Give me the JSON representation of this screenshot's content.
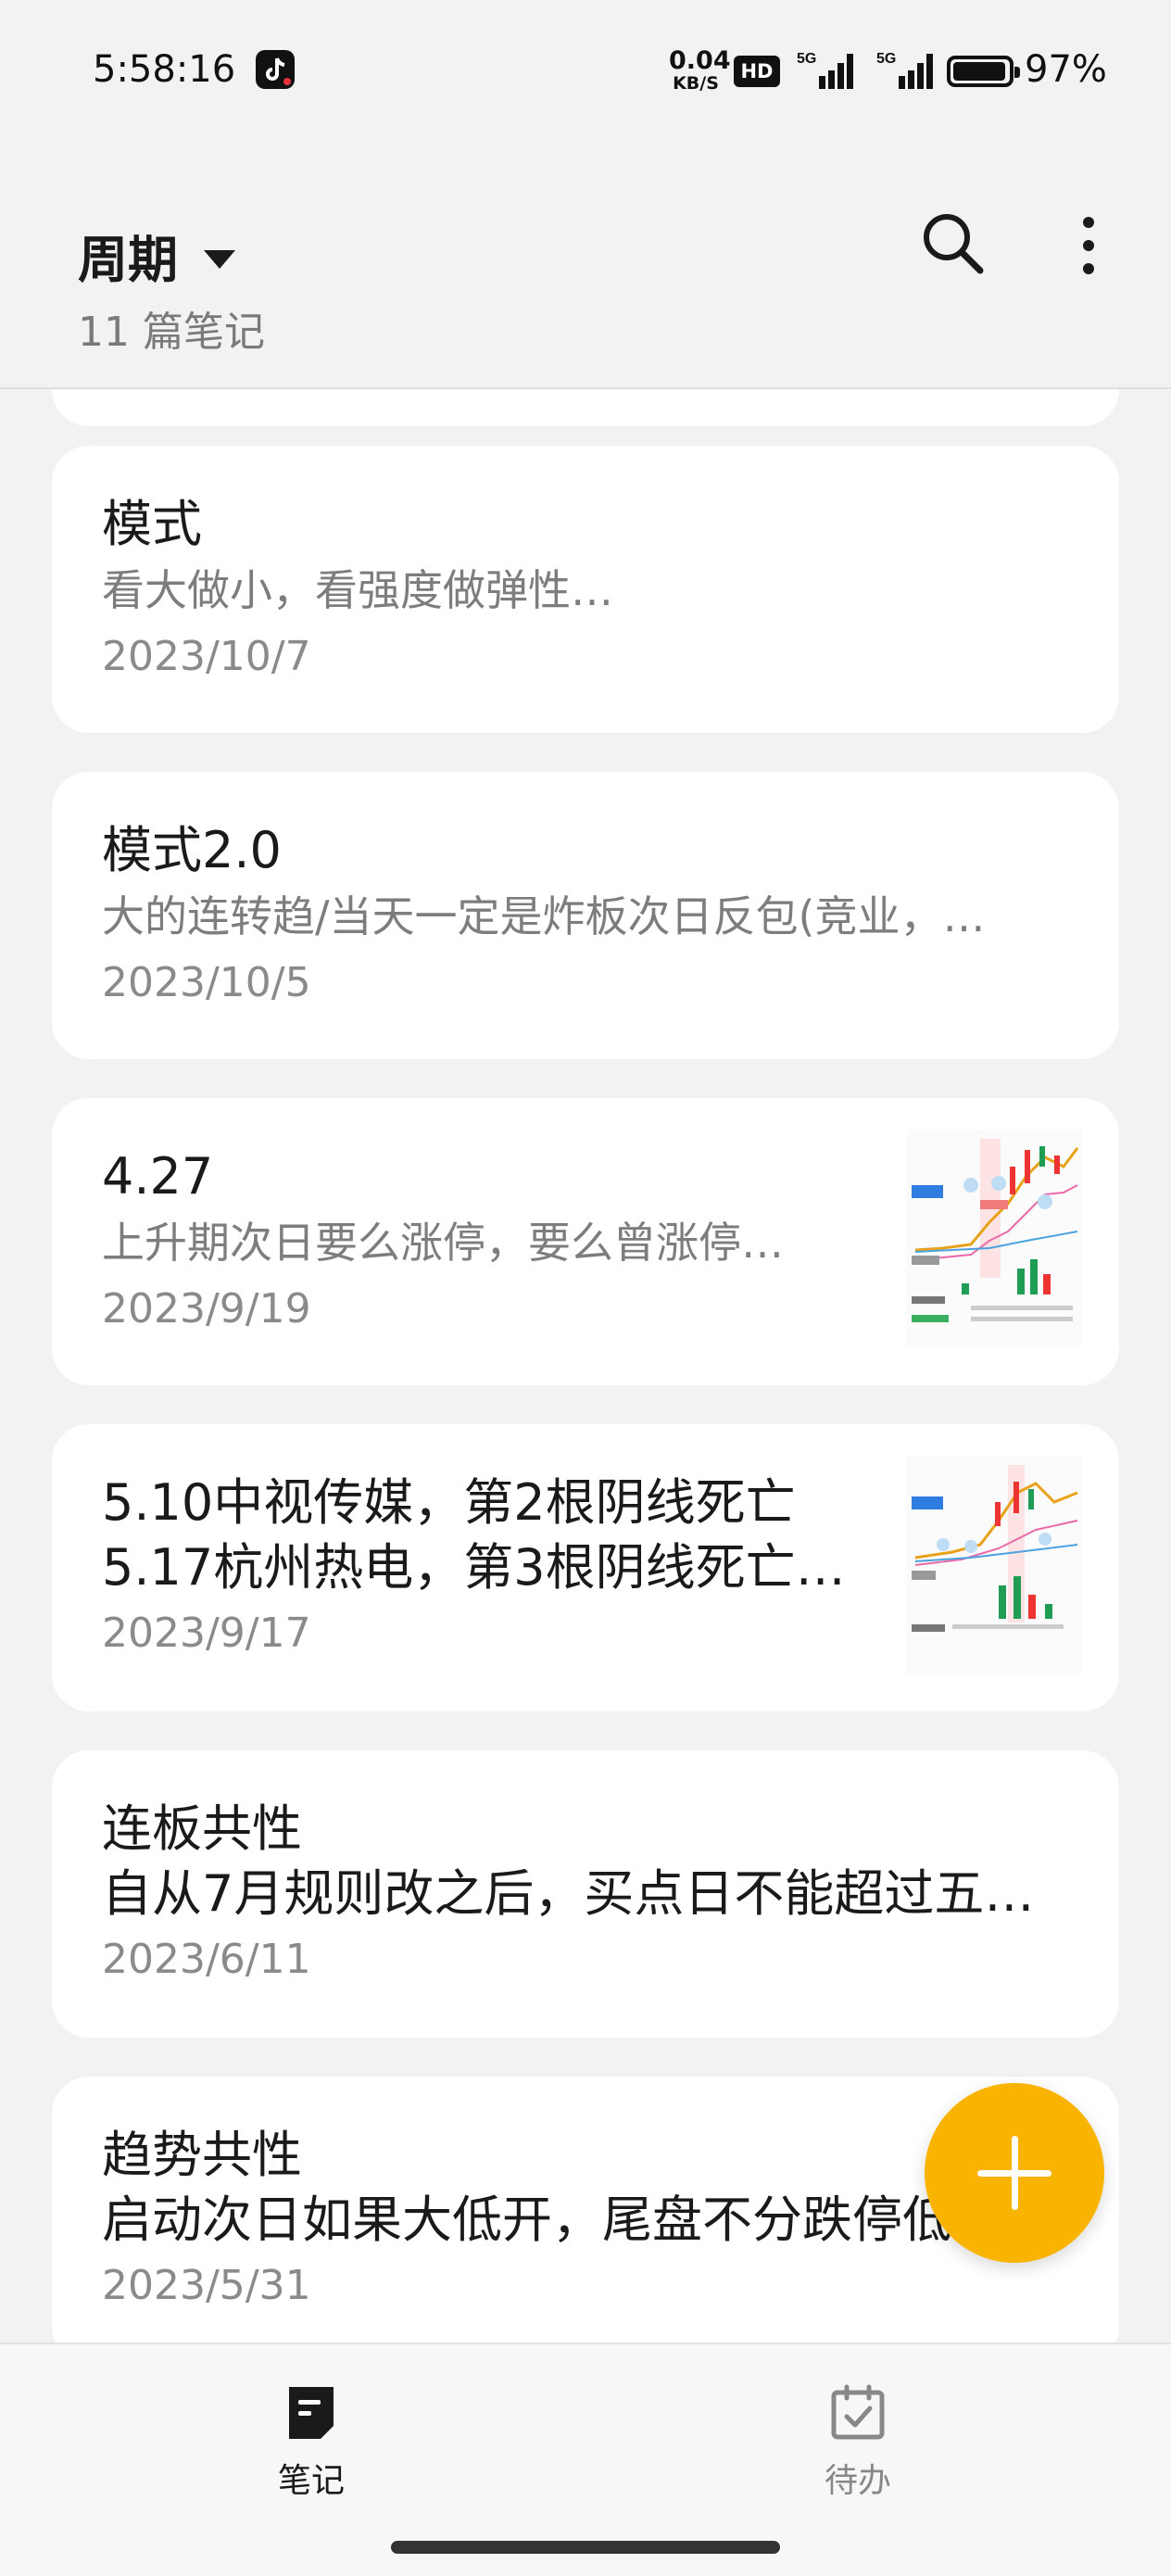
{
  "status_bar": {
    "time": "5:58:16",
    "net_speed_value": "0.04",
    "net_speed_unit": "KB/S",
    "hd_label": "HD",
    "signal_label": "5G",
    "battery_percent": "97%",
    "battery_level": 0.97
  },
  "header": {
    "folder_name": "周期",
    "note_count": "11 篇笔记"
  },
  "notes": [
    {
      "title": "模式",
      "snippet": "看大做小，看强度做弹性…",
      "date": "2023/10/7"
    },
    {
      "title": "模式2.0",
      "snippet": "大的连转趋/当天一定是炸板次日反包(竞业，…",
      "date": "2023/10/5"
    },
    {
      "title": "4.27",
      "snippet": "上升期次日要么涨停，要么曾涨停…",
      "date": "2023/9/19"
    },
    {
      "title": "5.10中视传媒，第2根阴线死亡",
      "title_line2": "5.17杭州热电，第3根阴线死亡…",
      "date": "2023/9/17"
    },
    {
      "title": "连板共性",
      "title_line2": "自从7月规则改之后，买点日不能超过五…",
      "date": "2023/6/11"
    },
    {
      "title": "趋势共性",
      "title_line2": "启动次日如果大低开，尾盘不分跌停低",
      "date": "2023/5/31"
    }
  ],
  "bottom_nav": {
    "notes_label": "笔记",
    "todo_label": "待办"
  },
  "colors": {
    "accent": "#f8b400",
    "background": "#f2f2f2",
    "card": "#ffffff"
  }
}
